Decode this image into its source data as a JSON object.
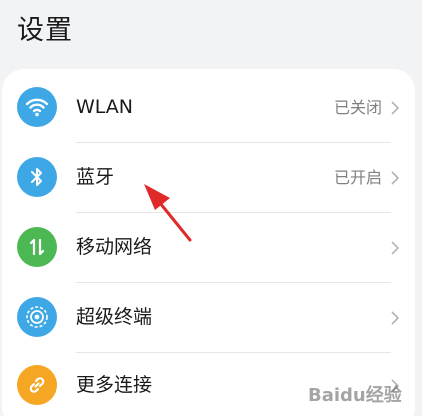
{
  "page": {
    "title": "设置"
  },
  "settings": {
    "items": [
      {
        "label": "WLAN",
        "status": "已关闭",
        "icon": "wifi-icon",
        "color": "#3ea8e6"
      },
      {
        "label": "蓝牙",
        "status": "已开启",
        "icon": "bluetooth-icon",
        "color": "#3ea8e6"
      },
      {
        "label": "移动网络",
        "status": "",
        "icon": "mobile-data-icon",
        "color": "#4cb854"
      },
      {
        "label": "超级终端",
        "status": "",
        "icon": "super-device-icon",
        "color": "#3ea8e6"
      },
      {
        "label": "更多连接",
        "status": "",
        "icon": "link-icon",
        "color": "#f5a623"
      }
    ]
  },
  "annotation": {
    "color": "#e02a2a"
  },
  "watermark": {
    "text": "Baidu经验"
  }
}
